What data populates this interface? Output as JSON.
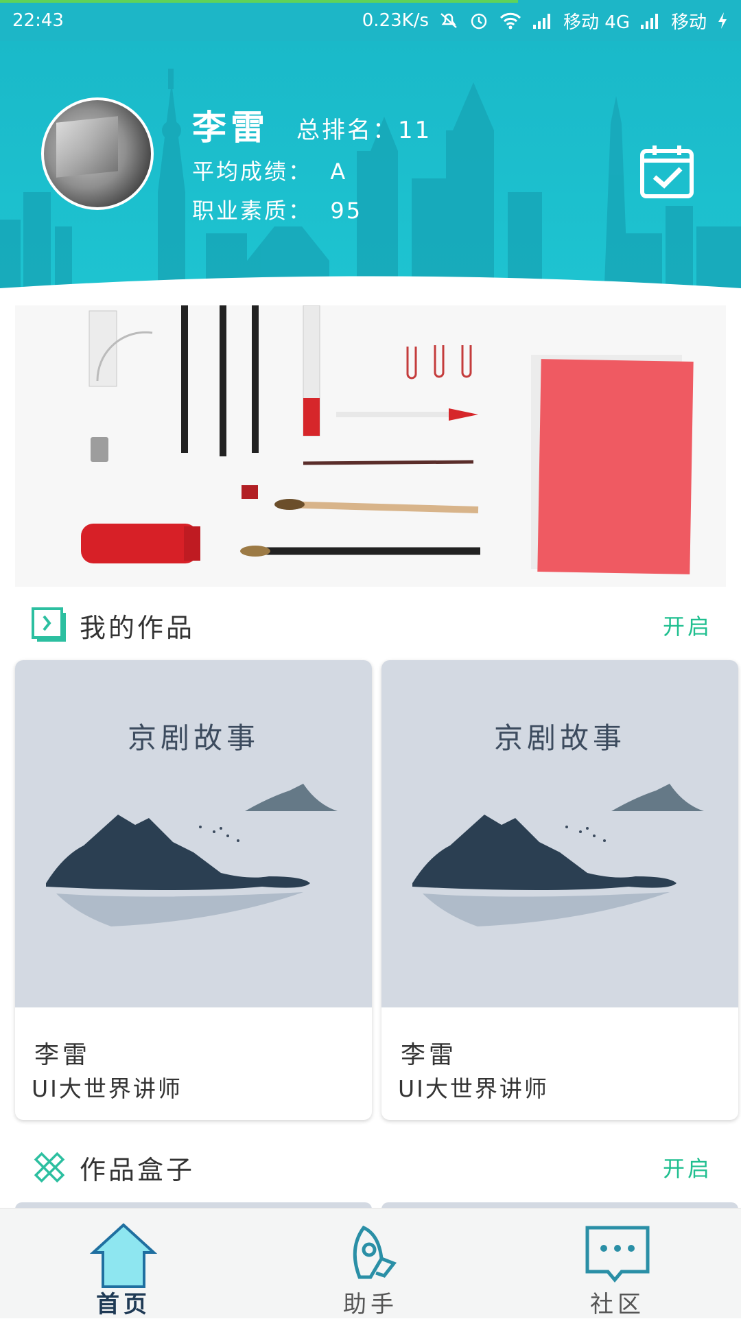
{
  "status_bar": {
    "time": "22:43",
    "net_speed": "0.23K/s",
    "carrier1": "移动 4G",
    "carrier2": "移动"
  },
  "profile": {
    "name": "李雷",
    "rank_label": "总排名：",
    "rank_value": "11",
    "avg_label": "平均成绩：",
    "avg_value": "A",
    "quality_label": "职业素质：",
    "quality_value": "95"
  },
  "works": {
    "title": "我的作品",
    "action": "开启",
    "items": [
      {
        "image_title": "京剧故事",
        "author": "李雷",
        "role": "UI大世界讲师"
      },
      {
        "image_title": "京剧故事",
        "author": "李雷",
        "role": "UI大世界讲师"
      }
    ]
  },
  "box": {
    "title": "作品盒子",
    "action": "开启"
  },
  "nav": {
    "items": [
      {
        "label": "首页",
        "icon": "home-icon",
        "active": true
      },
      {
        "label": "助手",
        "icon": "rocket-icon",
        "active": false
      },
      {
        "label": "社区",
        "icon": "chat-icon",
        "active": false
      }
    ]
  },
  "colors": {
    "header": "#1db6c7",
    "accent": "#1fbf8f",
    "nav_active": "#1f3a55"
  }
}
